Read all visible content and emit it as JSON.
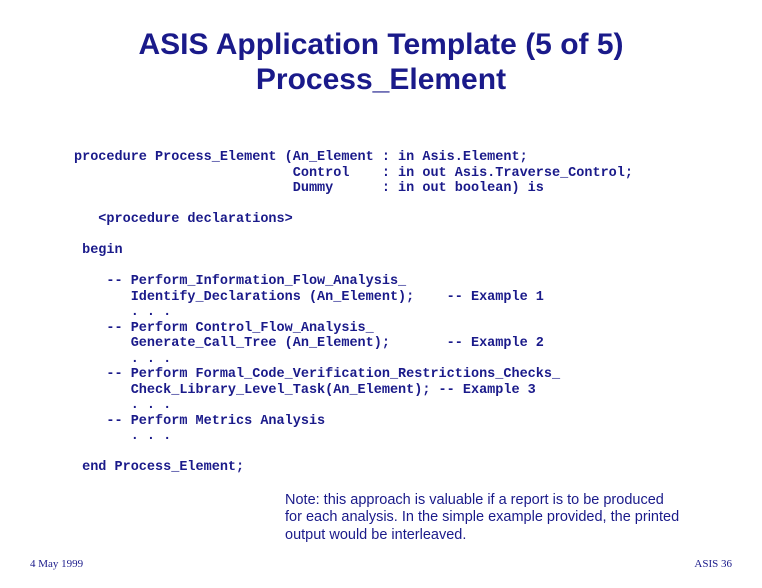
{
  "title_line1": "ASIS Application Template (5 of 5)",
  "title_line2": "Process_Element",
  "code": "procedure Process_Element (An_Element : in Asis.Element;\n                           Control    : in out Asis.Traverse_Control;\n                           Dummy      : in out boolean) is\n\n   <procedure declarations>\n\n begin\n\n    -- Perform_Information_Flow_Analysis_\n       Identify_Declarations (An_Element);    -- Example 1\n       . . .\n    -- Perform Control_Flow_Analysis_\n       Generate_Call_Tree (An_Element);       -- Example 2\n       . . .\n    -- Perform Formal_Code_Verification_Restrictions_Checks_\n       Check_Library_Level_Task(An_Element); -- Example 3\n       . . .\n    -- Perform Metrics Analysis\n       . . .\n\n end Process_Element;",
  "note": "Note: this approach is valuable if a report is to be produced for each analysis. In the simple example provided, the printed output would be interleaved.",
  "footer_left": "4 May 1999",
  "footer_right": "ASIS 36"
}
